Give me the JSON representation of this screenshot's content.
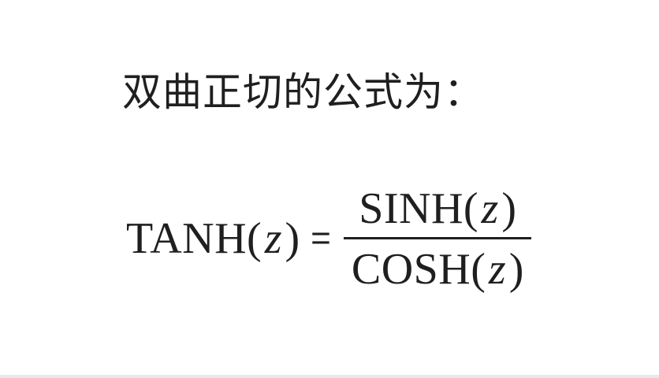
{
  "intro_text": "双曲正切的公式为：",
  "formula": {
    "lhs": {
      "function": "TANH",
      "open_paren": "(",
      "variable": "z",
      "close_paren": ")"
    },
    "equals": "=",
    "numerator": {
      "function": "SINH",
      "open_paren": "(",
      "variable": "z",
      "close_paren": ")"
    },
    "denominator": {
      "function": "COSH",
      "open_paren": "(",
      "variable": "z",
      "close_paren": ")"
    }
  }
}
